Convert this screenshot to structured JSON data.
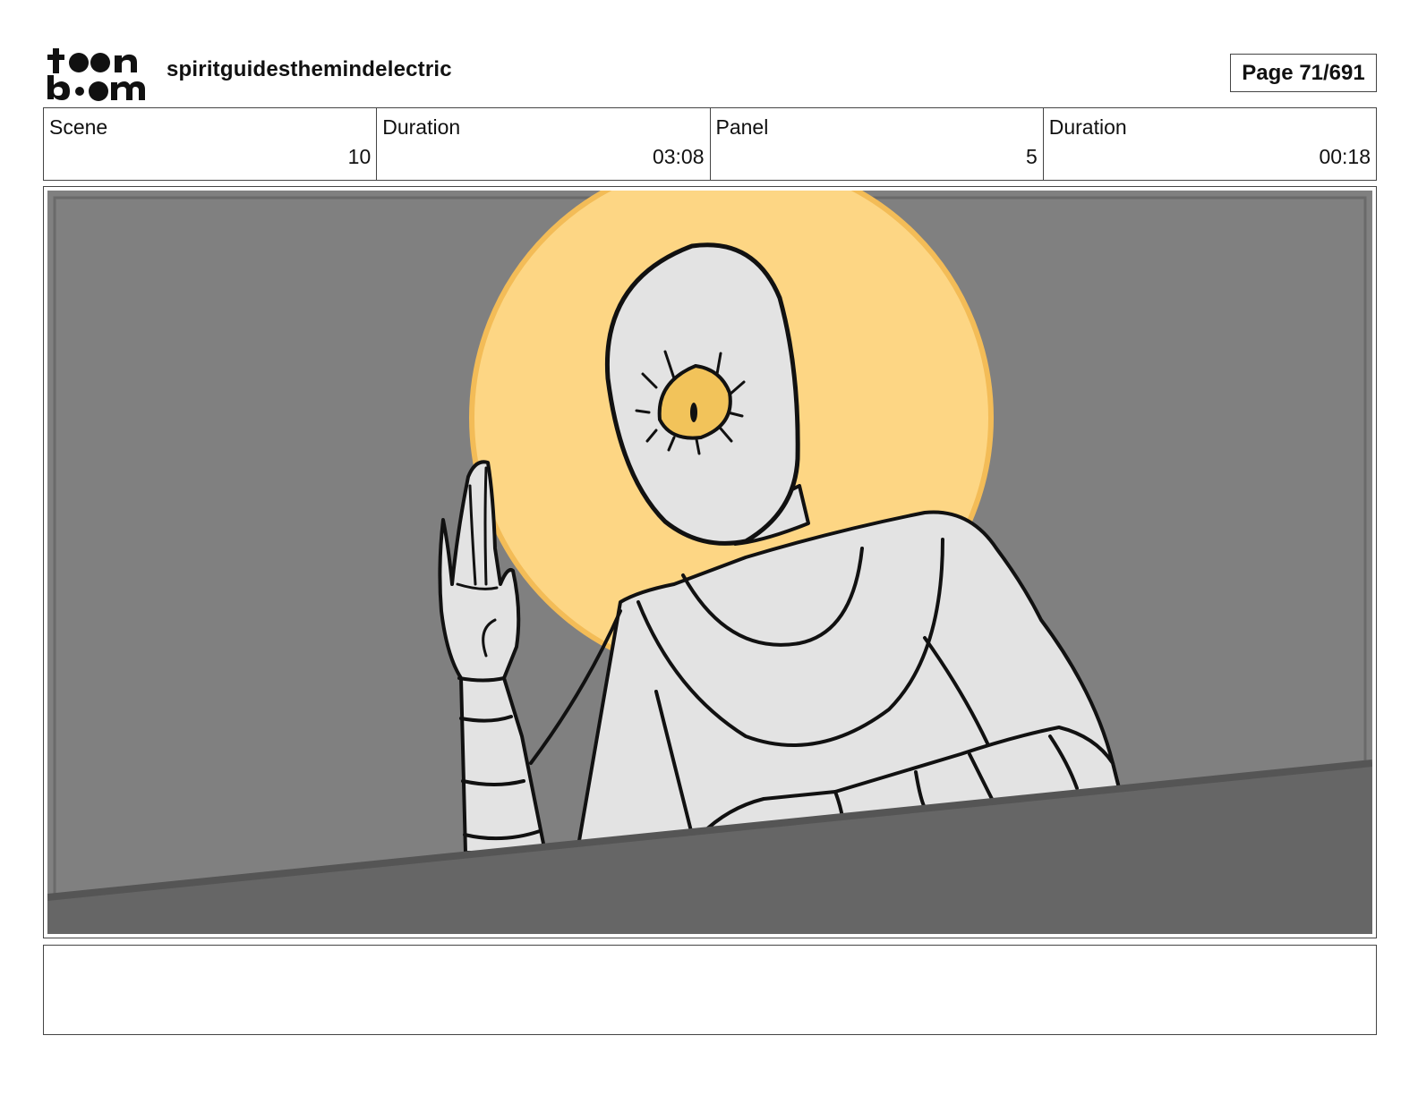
{
  "header": {
    "logo_text": "toon boom",
    "project_title": "spiritguidesthemindelectric",
    "page_label": "Page 71/691"
  },
  "info": {
    "scene_label": "Scene",
    "scene_value": "10",
    "scene_duration_label": "Duration",
    "scene_duration_value": "03:08",
    "panel_label": "Panel",
    "panel_value": "5",
    "panel_duration_label": "Duration",
    "panel_duration_value": "00:18"
  },
  "colors": {
    "background_gray": "#808080",
    "halo_yellow": "#fdd684",
    "eye_yellow": "#f2c35a",
    "body_gray": "#e3e3e3",
    "foreground_dark": "#666666"
  },
  "notes": ""
}
